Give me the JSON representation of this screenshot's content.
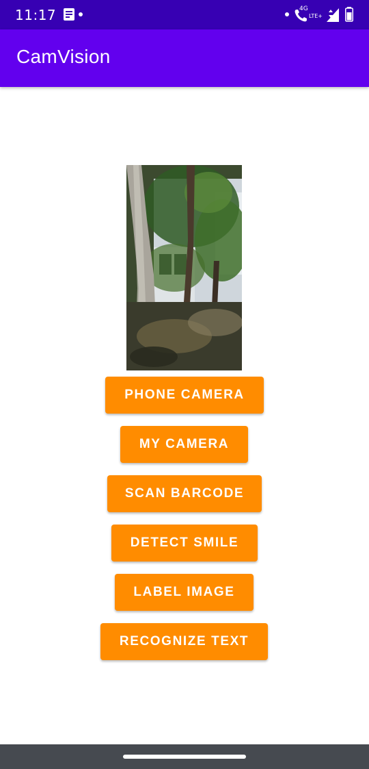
{
  "status_bar": {
    "time": "11:17",
    "network_label": "4G",
    "network_sub_label": "LTE+",
    "background_color": "#3700b3",
    "icons": [
      "notification-icon",
      "call-icon",
      "signal-icon",
      "battery-icon"
    ]
  },
  "app_bar": {
    "title": "CamVision",
    "background_color": "#6200ee"
  },
  "photo": {
    "description_icon": "tree-photo"
  },
  "buttons": {
    "phone_camera": "PHONE CAMERA",
    "my_camera": "MY CAMERA",
    "scan_barcode": "SCAN BARCODE",
    "detect_smile": "DETECT SMILE",
    "label_image": "LABEL IMAGE",
    "recognize_text": "RECOGNIZE TEXT",
    "color": "#ff8c00"
  },
  "nav_bar": {
    "background_color": "#464a50"
  }
}
